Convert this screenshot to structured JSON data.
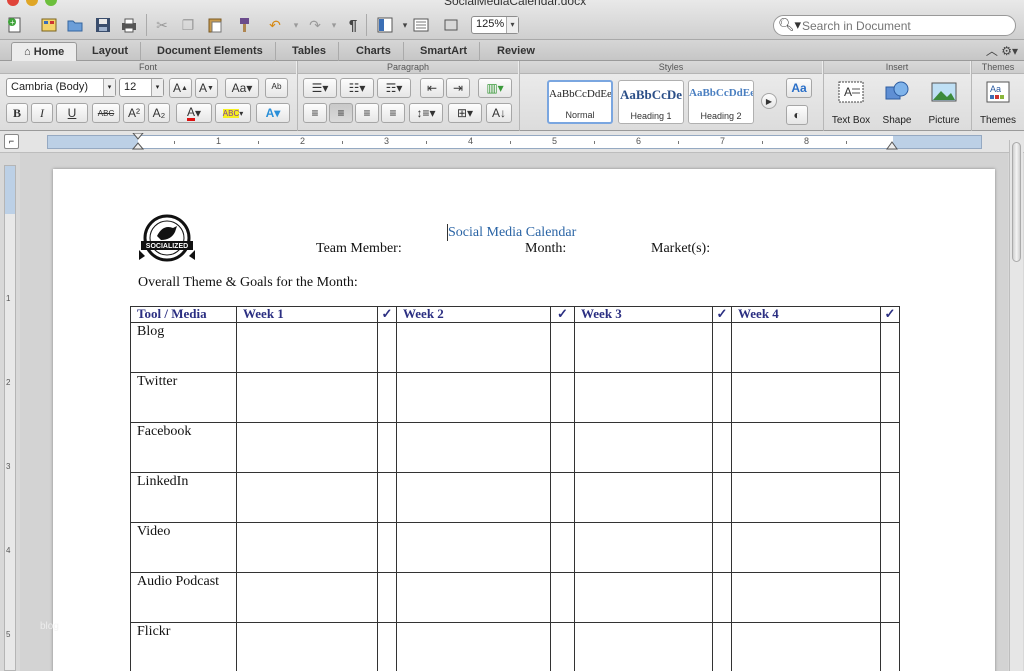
{
  "window": {
    "title": "SocialMediaCalendar.docx"
  },
  "toolbar": {
    "zoom": "125%",
    "search_placeholder": "Search in Document",
    "pilcrow": "¶"
  },
  "tabs": [
    {
      "label": "Home"
    },
    {
      "label": "Layout"
    },
    {
      "label": "Document Elements"
    },
    {
      "label": "Tables"
    },
    {
      "label": "Charts"
    },
    {
      "label": "SmartArt"
    },
    {
      "label": "Review"
    }
  ],
  "ribbon": {
    "groups": {
      "font": "Font",
      "paragraph": "Paragraph",
      "styles": "Styles",
      "insert": "Insert",
      "themes": "Themes"
    },
    "font_name": "Cambria (Body)",
    "font_size": "12",
    "bold": "B",
    "italic": "I",
    "underline": "U",
    "strike": "ABC",
    "styles": [
      {
        "sample": "AaBbCcDdEe",
        "name": "Normal"
      },
      {
        "sample": "AaBbCcDe",
        "name": "Heading 1"
      },
      {
        "sample": "AaBbCcDdEe",
        "name": "Heading 2"
      }
    ],
    "insert": {
      "text_box": "Text Box",
      "shape": "Shape",
      "picture": "Picture"
    },
    "themes_label": "Themes"
  },
  "ruler": {
    "numbers": [
      "1",
      "2",
      "3",
      "4",
      "5",
      "6",
      "7",
      "8"
    ]
  },
  "vruler": {
    "numbers": [
      "1",
      "2",
      "3",
      "4",
      "5"
    ]
  },
  "document": {
    "logo_text": "SOCIALIZED",
    "title": "Social Media Calendar",
    "team_member": "Team Member:",
    "month": "Month:",
    "markets": "Market(s):",
    "theme_goals": "Overall Theme & Goals for the Month:",
    "table": {
      "headers": [
        "Tool / Media",
        "Week 1",
        "✓",
        "Week 2",
        "✓",
        "Week 3",
        "✓",
        "Week 4",
        "✓"
      ],
      "rows": [
        "Blog",
        "Twitter",
        "Facebook",
        "LinkedIn",
        "Video",
        "Audio Podcast",
        "Flickr"
      ]
    }
  },
  "watermark": "blog"
}
